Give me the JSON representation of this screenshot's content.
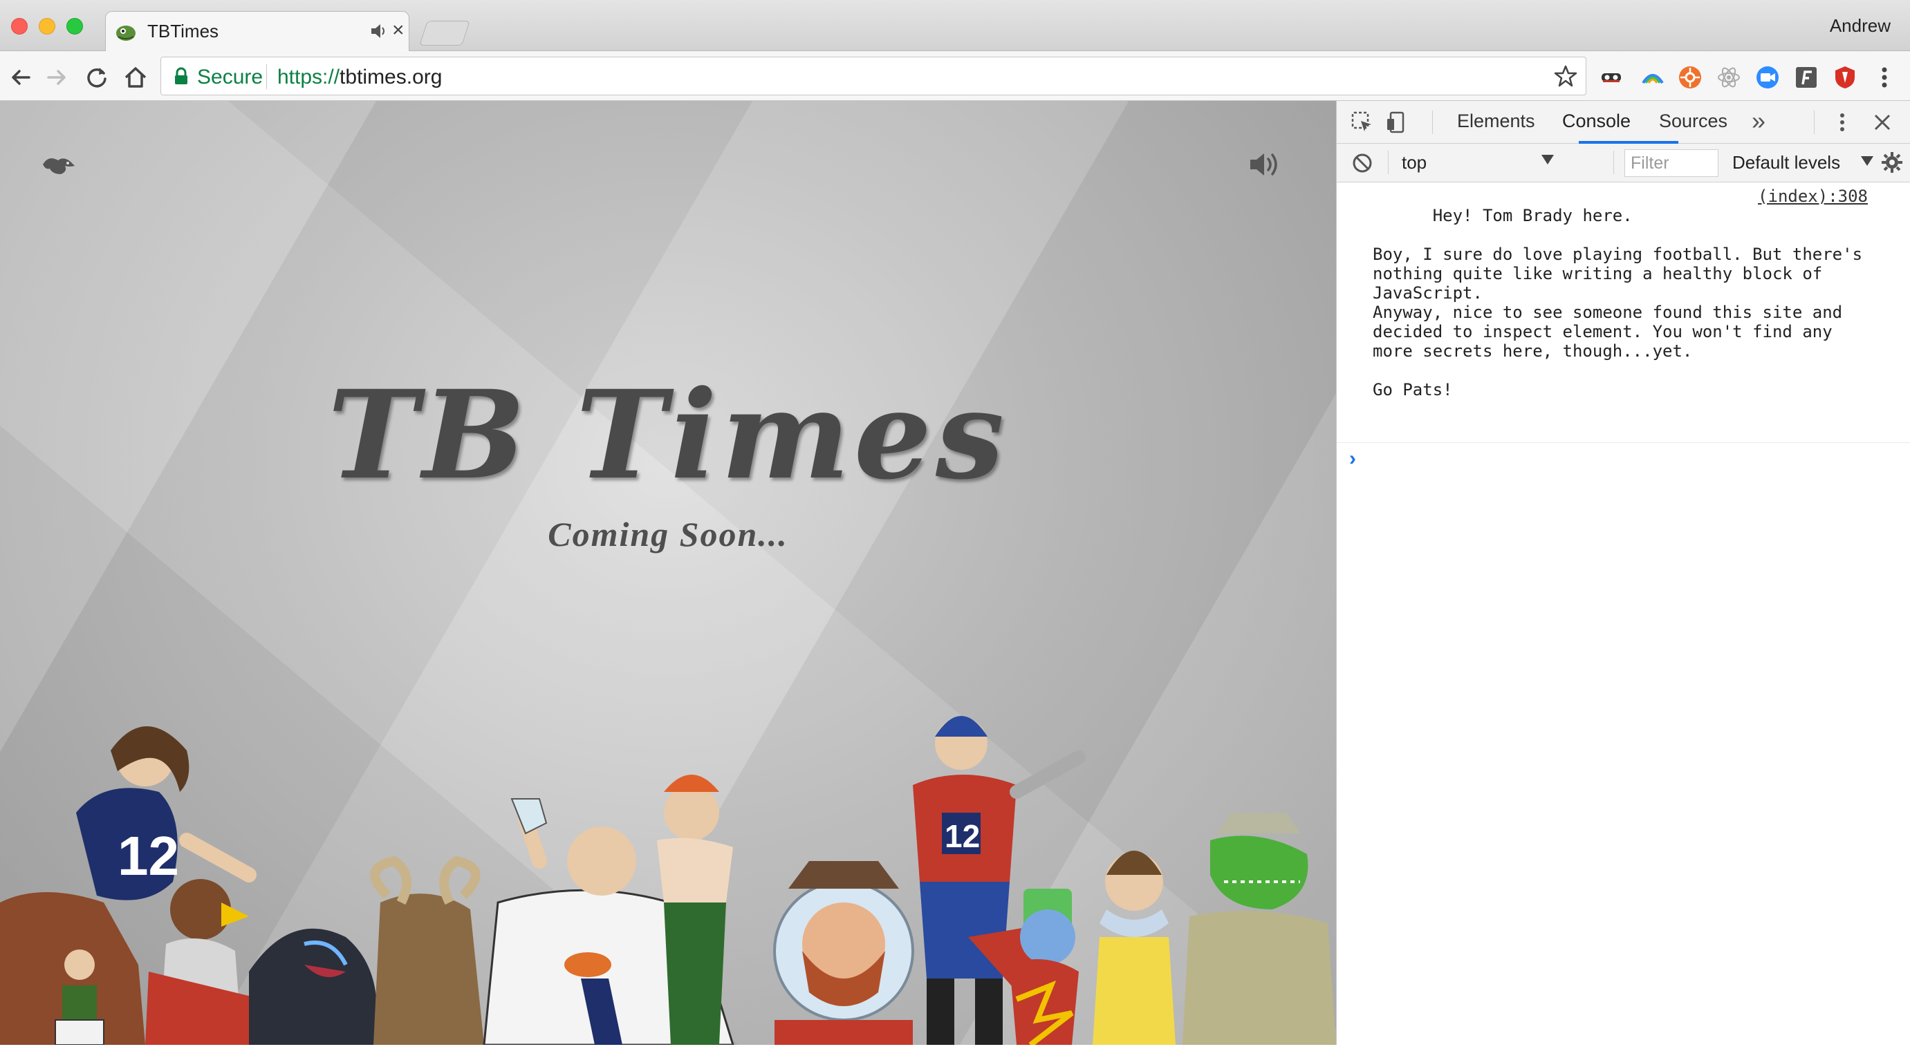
{
  "window": {
    "tab_title": "TBTimes",
    "profile_name": "Andrew"
  },
  "toolbar": {
    "secure_label": "Secure",
    "url_scheme": "https://",
    "url_host": "tbtimes.org"
  },
  "page": {
    "title": "TB Times",
    "subtitle": "Coming Soon..."
  },
  "devtools": {
    "tabs": [
      "Elements",
      "Console",
      "Sources"
    ],
    "active_tab": "Console",
    "context": "top",
    "filter_placeholder": "Filter",
    "levels": "Default levels",
    "messages": [
      {
        "text": "Hey! Tom Brady here.\n\nBoy, I sure do love playing football. But there's nothing quite like writing a healthy block of JavaScript.\nAnyway, nice to see someone found this site and decided to inspect element. You won't find any more secrets here, though...yet.\n\nGo Pats!",
        "source": "(index):308"
      }
    ]
  },
  "colors": {
    "secure_green": "#0b8043",
    "devtools_accent": "#1a73e8",
    "title_gray": "#4a4a4a"
  }
}
